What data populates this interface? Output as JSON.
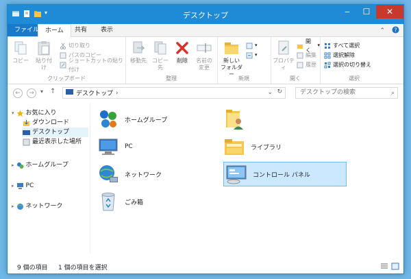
{
  "window": {
    "title": "デスクトップ"
  },
  "ribbon_tabs": {
    "file": "ファイル",
    "home": "ホーム",
    "share": "共有",
    "view": "表示"
  },
  "clipboard": {
    "copy": "コピー",
    "paste": "貼り付け",
    "cut": "切り取り",
    "copy_path": "パスのコピー",
    "paste_shortcut": "ショートカットの貼り付け",
    "label": "クリップボード"
  },
  "organize": {
    "move_to": "移動先",
    "copy_to": "コピー先",
    "delete": "削除",
    "rename_line1": "名前の",
    "rename_line2": "変更",
    "label": "整理"
  },
  "new": {
    "new_folder_line1": "新しい",
    "new_folder_line2": "フォルダー",
    "label": "新規"
  },
  "open": {
    "properties": "プロパティ",
    "open": "開く",
    "edit": "編集",
    "history": "履歴",
    "label": "開く"
  },
  "select": {
    "select_all": "すべて選択",
    "select_none": "選択解除",
    "invert": "選択の切り替え",
    "label": "選択"
  },
  "address": {
    "path": "デスクトップ",
    "search_placeholder": "デスクトップの検索"
  },
  "nav_pane": {
    "favorites": "お気に入り",
    "downloads": "ダウンロード",
    "desktop": "デスクトップ",
    "recent": "最近表示した場所",
    "homegroup": "ホームグループ",
    "pc": "PC",
    "network": "ネットワーク"
  },
  "items": {
    "homegroup": "ホームグループ",
    "pc": "PC",
    "network": "ネットワーク",
    "recycle": "ごみ箱",
    "libraries": "ライブラリ",
    "control_panel": "コントロール パネル"
  },
  "status": {
    "count": "9 個の項目",
    "selected": "1 個の項目を選択"
  },
  "colors": {
    "titlebar": "#1f8ad6",
    "file_tab": "#1979ca",
    "close_button": "#c7392d",
    "selection": "#cce8ff"
  }
}
